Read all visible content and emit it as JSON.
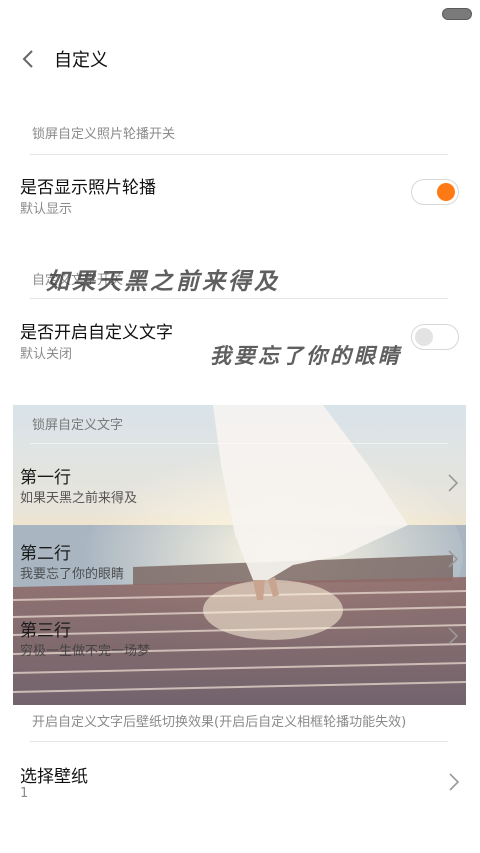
{
  "header": {
    "title": "自定义"
  },
  "sections": {
    "carousel_header": "锁屏自定义照片轮播开关",
    "custom_text_switch_header": "自定义文字开关",
    "custom_text_header": "锁屏自定义文字"
  },
  "show_carousel": {
    "title": "是否显示照片轮播",
    "subtitle": "默认显示",
    "enabled": true
  },
  "custom_text_toggle": {
    "title": "是否开启自定义文字",
    "subtitle": "默认关闭",
    "enabled": false
  },
  "overlay": {
    "line1": "如果天黑之前来得及",
    "line2": "我要忘了你的眼睛"
  },
  "lines": [
    {
      "title": "第一行",
      "value": "如果天黑之前来得及"
    },
    {
      "title": "第二行",
      "value": "我要忘了你的眼睛"
    },
    {
      "title": "第三行",
      "value": "穷极一生做不完一场梦"
    }
  ],
  "wallpaper_note": "开启自定义文字后壁纸切换效果(开启后自定义相框轮播功能失效)",
  "wallpaper": {
    "title": "选择壁纸",
    "value": "1"
  },
  "colors": {
    "accent": "#ff7a14",
    "divider": "#e4e4e4",
    "secondary_text": "#8a8a8a"
  }
}
